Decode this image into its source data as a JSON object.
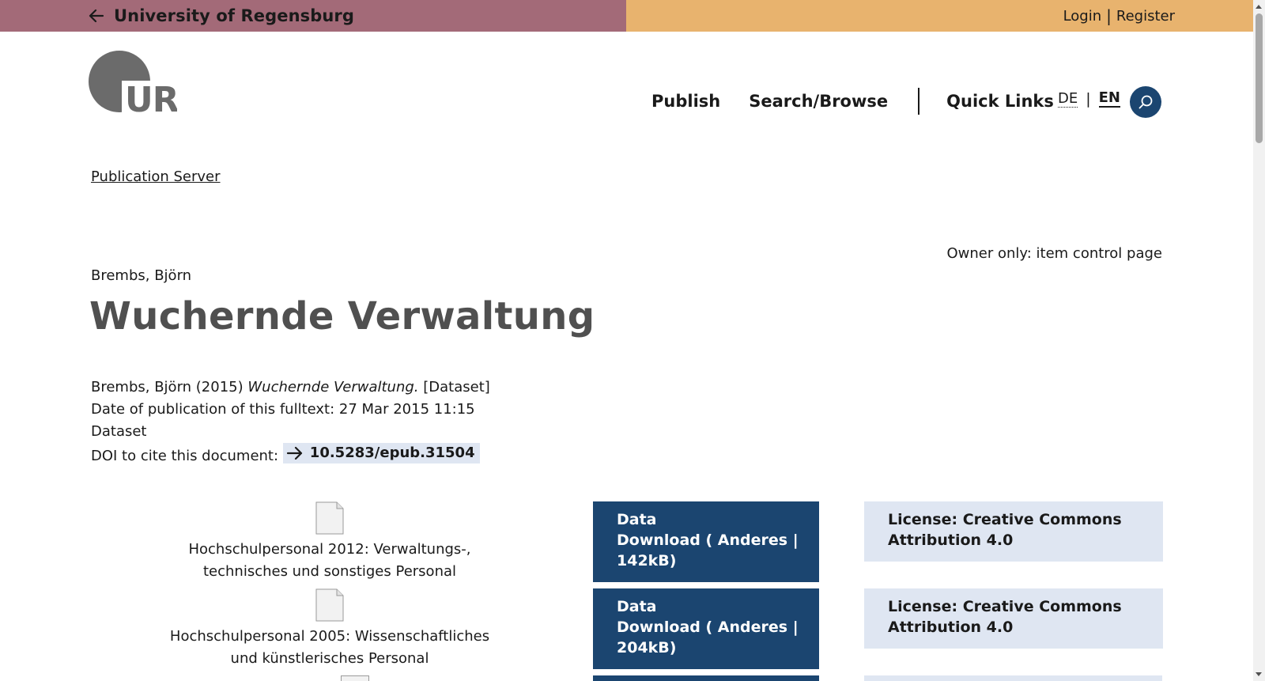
{
  "topbar": {
    "back_icon": "arrow-left-icon",
    "university": "University of Regensburg",
    "login": "Login",
    "separator": "|",
    "register": "Register",
    "left_color": "#a36a78",
    "right_color": "#e8b36e"
  },
  "logo": {
    "text": "UR"
  },
  "nav": {
    "publish": "Publish",
    "search_browse": "Search/Browse",
    "quick_links": "Quick Links",
    "lang_de": "DE",
    "lang_en": "EN",
    "lang_separator": "|",
    "search_icon": "search-icon",
    "accent": "#1b4570"
  },
  "breadcrumb": "Publication Server",
  "owner_link": "Owner only: item control page",
  "record": {
    "author": "Brembs, Björn",
    "title": "Wuchernde Verwaltung",
    "citation_author": "Brembs, Björn (2015)",
    "citation_title": "Wuchernde Verwaltung.",
    "citation_type": "[Dataset]",
    "date_line": "Date of publication of this fulltext: 27 Mar 2015 11:15",
    "type": "Dataset",
    "doi_label": "DOI to cite this document:",
    "doi": "10.5283/epub.31504"
  },
  "files": [
    {
      "name": "Hochschulpersonal 2012: Verwaltungs-, technisches und sonstiges Personal",
      "download_line1": "Data",
      "download_line2": "Download ( Anderes |",
      "download_line3": "142kB)",
      "license_line1": "License: Creative Commons",
      "license_line2": "Attribution 4.0"
    },
    {
      "name": "Hochschulpersonal 2005: Wissenschaftliches und künstlerisches Personal",
      "download_line1": "Data",
      "download_line2": "Download ( Anderes |",
      "download_line3": "204kB)",
      "license_line1": "License: Creative Commons",
      "license_line2": "Attribution 4.0"
    }
  ]
}
